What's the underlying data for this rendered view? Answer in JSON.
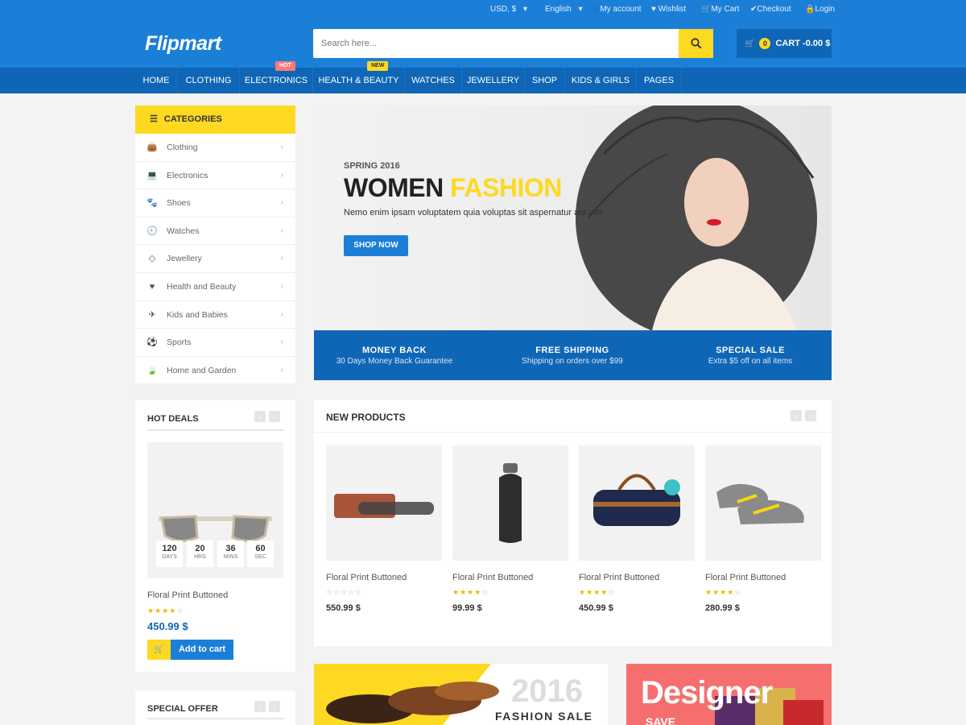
{
  "topbar": {
    "currency": "USD, $",
    "language": "English",
    "links": [
      "My account",
      "Wishlist",
      "My Cart",
      "Checkout",
      "Login"
    ]
  },
  "header": {
    "logo": "Flipmart",
    "search_placeholder": "Search here...",
    "cart_count": "0",
    "cart_label": "CART -0.00 $"
  },
  "nav": {
    "items": [
      "HOME",
      "CLOTHING",
      "ELECTRONICS",
      "HEALTH & BEAUTY",
      "WATCHES",
      "JEWELLERY",
      "SHOP",
      "KIDS & GIRLS",
      "PAGES"
    ],
    "badge_hot": "HOT",
    "badge_new": "NEW"
  },
  "sidebar": {
    "categories_title": "CATEGORIES",
    "categories": [
      "Clothing",
      "Electronics",
      "Shoes",
      "Watches",
      "Jewellery",
      "Health and Beauty",
      "Kids and Babies",
      "Sports",
      "Home and Garden"
    ]
  },
  "hero": {
    "subtitle": "SPRING 2016",
    "title_a": "WOMEN",
    "title_b": "FASHION",
    "text": "Nemo enim ipsam voluptatem quia voluptas sit aspernatur aut odit",
    "button": "SHOP NOW"
  },
  "features": [
    {
      "title": "MONEY BACK",
      "text": "30 Days Money Back Guarantee"
    },
    {
      "title": "FREE SHIPPING",
      "text": "Shipping on orders over $99"
    },
    {
      "title": "SPECIAL SALE",
      "text": "Extra $5 off on all items"
    }
  ],
  "hot_deals": {
    "title": "HOT DEALS",
    "timer": [
      {
        "value": "120",
        "unit": "DAYS"
      },
      {
        "value": "20",
        "unit": "HRS"
      },
      {
        "value": "36",
        "unit": "MINS"
      },
      {
        "value": "60",
        "unit": "SEC"
      }
    ],
    "product_name": "Floral Print Buttoned",
    "rating": 4,
    "price": "450.99 $",
    "add_to_cart": "Add to cart"
  },
  "new_products": {
    "title": "NEW PRODUCTS",
    "items": [
      {
        "name": "Floral Print Buttoned",
        "rating": 0,
        "price": "550.99 $"
      },
      {
        "name": "Floral Print Buttoned",
        "rating": 4,
        "price": "99.99 $"
      },
      {
        "name": "Floral Print Buttoned",
        "rating": 4,
        "price": "450.99 $"
      },
      {
        "name": "Floral Print Buttoned",
        "rating": 4,
        "price": "280.99 $"
      }
    ]
  },
  "special_offer": {
    "title": "SPECIAL OFFER"
  },
  "banners": {
    "year": "2016",
    "fashion_sale": "FASHION SALE",
    "designer": "Designer",
    "save": "SAVE"
  },
  "colors": {
    "primary": "#1b7fd8",
    "dark_blue": "#0f66b6",
    "accent_yellow": "#fdd922",
    "hot_pink": "#ff7878"
  }
}
